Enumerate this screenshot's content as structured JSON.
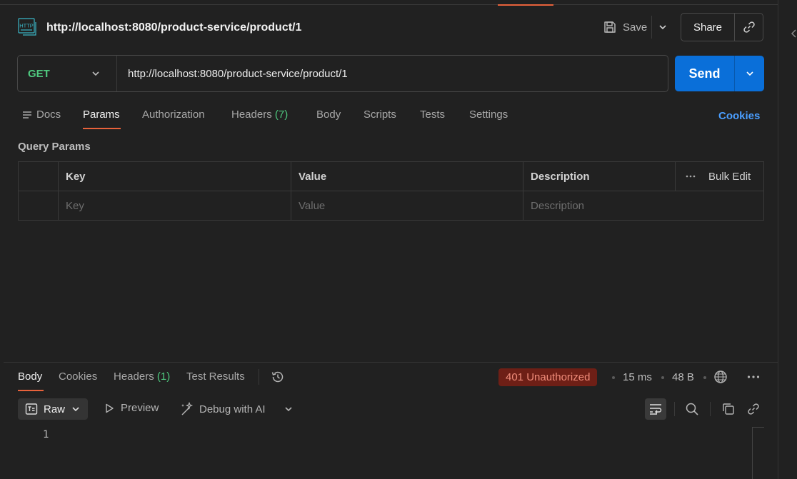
{
  "header": {
    "icon": "http-icon",
    "title": "http://localhost:8080/product-service/product/1",
    "save_label": "Save",
    "share_label": "Share"
  },
  "request": {
    "method": "GET",
    "url": "http://localhost:8080/product-service/product/1",
    "send_label": "Send"
  },
  "tabs": {
    "docs": "Docs",
    "params": "Params",
    "authorization": "Authorization",
    "headers": "Headers",
    "headers_count": "(7)",
    "body": "Body",
    "scripts": "Scripts",
    "tests": "Tests",
    "settings": "Settings",
    "active": "Params"
  },
  "cookies_link": "Cookies",
  "query_params": {
    "title": "Query Params",
    "columns": [
      "Key",
      "Value",
      "Description"
    ],
    "bulk_edit": "Bulk Edit",
    "placeholders": [
      "Key",
      "Value",
      "Description"
    ]
  },
  "response": {
    "tabs": {
      "body": "Body",
      "cookies": "Cookies",
      "headers": "Headers",
      "headers_count": "(1)",
      "test_results": "Test Results",
      "active": "Body"
    },
    "status": "401 Unauthorized",
    "time": "15 ms",
    "size": "48 B",
    "format_label": "Raw",
    "preview_label": "Preview",
    "debug_label": "Debug with AI",
    "line_numbers": [
      "1"
    ]
  },
  "colors": {
    "accent": "#e8623b",
    "send": "#0a6fd9",
    "method_get": "#4fc97f",
    "status_error_bg": "#6e1f16",
    "link": "#4a9eff"
  }
}
